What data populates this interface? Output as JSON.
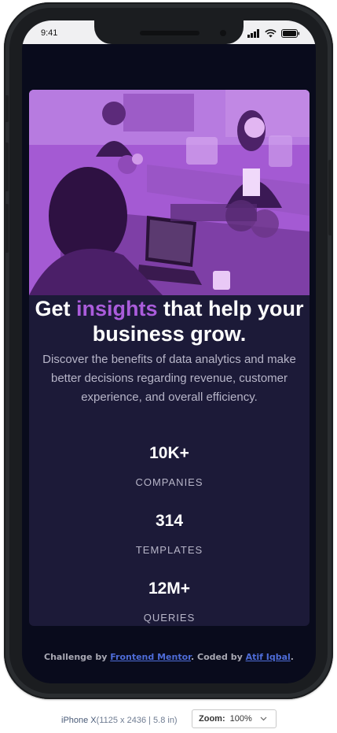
{
  "status_bar": {
    "time": "9:41"
  },
  "hero": {
    "image_name": "hero-photo-office-team-purple-tint",
    "tint_color": "#a45ad3"
  },
  "headline": {
    "prefix": "Get ",
    "accent": "insights",
    "suffix": " that help your business grow.",
    "accent_color": "#aa5cdb"
  },
  "description": "Discover the benefits of data analytics and make better decisions regarding revenue, customer experience, and overall efficiency.",
  "stats": [
    {
      "value": "10K+",
      "label": "COMPANIES"
    },
    {
      "value": "314",
      "label": "TEMPLATES"
    },
    {
      "value": "12M+",
      "label": "QUERIES"
    }
  ],
  "attribution": {
    "prefix": "Challenge by ",
    "link1": "Frontend Mentor",
    "middle": ". Coded by ",
    "link2": "Atif Iqbal",
    "suffix": "."
  },
  "device_bar": {
    "device_name": "iPhone X",
    "device_specs": "(1125 x 2436 | 5.8 in)",
    "zoom_label": "Zoom:",
    "zoom_value": "100%"
  },
  "colors": {
    "screen_bg": "#090b1c",
    "card_bg": "#1c1a38",
    "accent": "#aa5cdb",
    "link": "#4e6cd8"
  }
}
